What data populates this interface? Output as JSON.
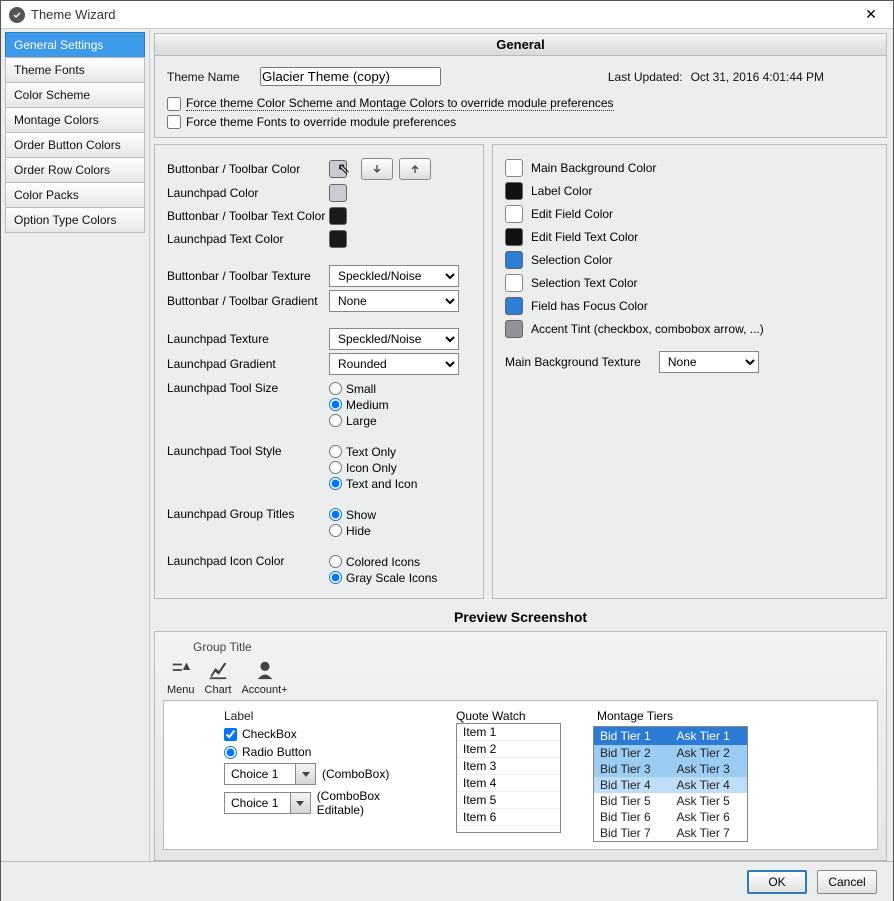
{
  "window": {
    "title": "Theme Wizard",
    "close_glyph": "✕"
  },
  "sidebar": {
    "tabs": [
      "General Settings",
      "Theme Fonts",
      "Color Scheme",
      "Montage Colors",
      "Order Button Colors",
      "Order Row Colors",
      "Color Packs",
      "Option Type Colors"
    ],
    "active_index": 0
  },
  "header": {
    "title": "General",
    "theme_name_label": "Theme Name",
    "theme_name_value": "Glacier Theme (copy)",
    "last_updated_label": "Last Updated:",
    "last_updated_value": "Oct 31, 2016  4:01:44 PM",
    "force_color_label": "Force theme Color Scheme and Montage Colors to override module preferences",
    "force_color_checked": false,
    "force_fonts_label": "Force theme Fonts to override module preferences",
    "force_fonts_checked": false
  },
  "left_form": {
    "buttonbar_color_label": "Buttonbar / Toolbar Color",
    "buttonbar_color_value": "#c9ccd2",
    "launchpad_color_label": "Launchpad Color",
    "launchpad_color_value": "#c9ccd2",
    "buttonbar_text_label": "Buttonbar / Toolbar Text Color",
    "buttonbar_text_value": "#1a1a1a",
    "launchpad_text_label": "Launchpad Text Color",
    "launchpad_text_value": "#1a1a1a",
    "buttonbar_texture_label": "Buttonbar / Toolbar Texture",
    "buttonbar_texture_value": "Speckled/Noise",
    "buttonbar_gradient_label": "Buttonbar / Toolbar Gradient",
    "buttonbar_gradient_value": "None",
    "launchpad_texture_label": "Launchpad Texture",
    "launchpad_texture_value": "Speckled/Noise",
    "launchpad_gradient_label": "Launchpad Gradient",
    "launchpad_gradient_value": "Rounded",
    "tool_size_label": "Launchpad Tool Size",
    "tool_size_options": [
      "Small",
      "Medium",
      "Large"
    ],
    "tool_size_selected": "Medium",
    "tool_style_label": "Launchpad Tool Style",
    "tool_style_options": [
      "Text Only",
      "Icon Only",
      "Text and Icon"
    ],
    "tool_style_selected": "Text and Icon",
    "group_titles_label": "Launchpad Group Titles",
    "group_titles_options": [
      "Show",
      "Hide"
    ],
    "group_titles_selected": "Show",
    "icon_color_label": "Launchpad Icon Color",
    "icon_color_options": [
      "Colored Icons",
      "Gray Scale Icons"
    ],
    "icon_color_selected": "Gray Scale Icons"
  },
  "right_form": {
    "rows": [
      {
        "label": "Main Background Color",
        "color": "#ffffff"
      },
      {
        "label": "Label Color",
        "color": "#111111"
      },
      {
        "label": "Edit Field Color",
        "color": "#ffffff"
      },
      {
        "label": "Edit Field Text Color",
        "color": "#111111"
      },
      {
        "label": "Selection Color",
        "color": "#2e7ed8"
      },
      {
        "label": "Selection Text Color",
        "color": "#ffffff"
      },
      {
        "label": "Field has Focus Color",
        "color": "#2e7ed8"
      },
      {
        "label": "Accent Tint (checkbox, combobox arrow, ...)",
        "color": "#8f9398"
      }
    ],
    "bg_texture_label": "Main Background Texture",
    "bg_texture_value": "None"
  },
  "preview": {
    "title": "Preview Screenshot",
    "group_title": "Group Title",
    "tools": [
      "Menu",
      "Chart",
      "Account+"
    ],
    "label": "Label",
    "checkbox_label": "CheckBox",
    "checkbox_checked": true,
    "radio_label": "Radio Button",
    "radio_checked": true,
    "combo1_value": "Choice 1",
    "combo1_hint": "(ComboBox)",
    "combo2_value": "Choice 1",
    "combo2_hint": "(ComboBox Editable)",
    "quote_watch_label": "Quote Watch",
    "quote_items": [
      "Item 1",
      "Item 2",
      "Item 3",
      "Item 4",
      "Item 5",
      "Item 6"
    ],
    "montage_label": "Montage Tiers",
    "montage_head": [
      "Bid Tier 1",
      "Ask Tier 1"
    ],
    "montage_rows": [
      {
        "b": "Bid Tier 2",
        "a": "Ask Tier 2",
        "sel": true
      },
      {
        "b": "Bid Tier 3",
        "a": "Ask Tier 3",
        "sel": true
      },
      {
        "b": "Bid Tier 4",
        "a": "Ask Tier 4",
        "sel2": true
      },
      {
        "b": "Bid Tier 5",
        "a": "Ask Tier 5"
      },
      {
        "b": "Bid Tier 6",
        "a": "Ask Tier 6"
      },
      {
        "b": "Bid Tier 7",
        "a": "Ask Tier 7"
      }
    ]
  },
  "footer": {
    "ok_label": "OK",
    "cancel_label": "Cancel"
  }
}
